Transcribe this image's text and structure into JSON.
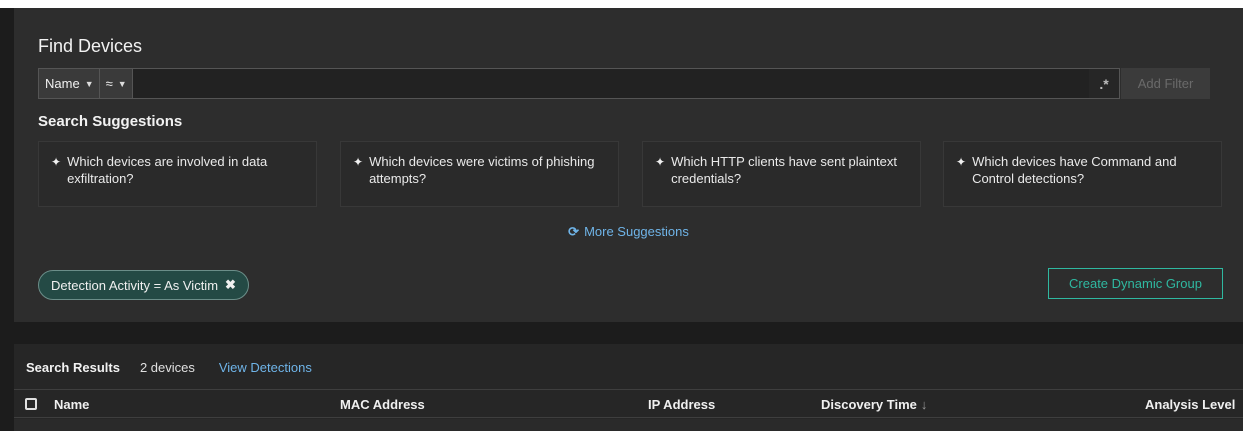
{
  "find": {
    "title": "Find Devices",
    "field_dropdown": "Name",
    "operator_dropdown": "≈",
    "input_value": "",
    "regex_symbol": ".*",
    "add_filter_label": "Add Filter"
  },
  "suggestions": {
    "title": "Search Suggestions",
    "items": [
      {
        "label": "Which devices are involved in data exfiltration?"
      },
      {
        "label": "Which devices were victims of phishing attempts?"
      },
      {
        "label": "Which HTTP clients have sent plaintext credentials?"
      },
      {
        "label": "Which devices have Command and Control detections?"
      }
    ],
    "more_label": "More Suggestions"
  },
  "active_filter": {
    "label": "Detection Activity = As Victim"
  },
  "create_group_label": "Create Dynamic Group",
  "results": {
    "label": "Search Results",
    "count": "2 devices",
    "view_detections": "View Detections",
    "columns": [
      "Name",
      "MAC Address",
      "IP Address",
      "Discovery Time",
      "Analysis Level"
    ]
  },
  "colors": {
    "panel_bg": "#2d2d2d",
    "accent_teal": "#2fb8a0",
    "link_blue": "#6fb4e8",
    "chip_bg": "#244a45"
  }
}
